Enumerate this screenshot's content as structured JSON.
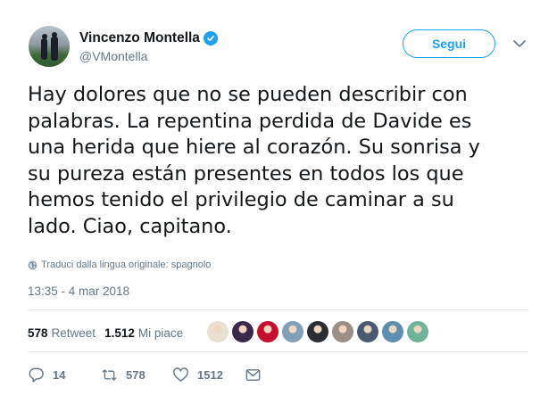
{
  "user": {
    "name": "Vincenzo Montella",
    "handle": "@VMontella"
  },
  "follow_button": {
    "label": "Segui"
  },
  "tweet": {
    "lines": [
      "Hay dolores que no se pueden describir con",
      "palabras. La repentina perdida de Davide es",
      "una herida que hiere al corazón. Su sonrisa y",
      "su pureza están presentes en todos los que",
      "hemos tenido el privilegio de caminar a su",
      "lado. Ciao, capitano."
    ],
    "translate_label": "Traduci dalla lingua originale: spagnolo",
    "timestamp": "13:35 - 4 mar 2018"
  },
  "stats": {
    "retweets_count": "578",
    "retweets_label": "Retweet",
    "likes_count": "1.512",
    "likes_label": "Mi piace"
  },
  "likers": [
    {
      "color": "#e8e0d0"
    },
    {
      "color": "#3a2a4a"
    },
    {
      "color": "#c8102e"
    },
    {
      "color": "#7fa0b8"
    },
    {
      "color": "#2b2f33"
    },
    {
      "color": "#9a8f86"
    },
    {
      "color": "#4a5a70"
    },
    {
      "color": "#5c8fb0"
    },
    {
      "color": "#6fb39a"
    }
  ],
  "actions": {
    "replies": "14",
    "retweets": "578",
    "likes": "1512"
  },
  "colors": {
    "accent": "#1da1f2",
    "secondary_text": "#657786"
  }
}
